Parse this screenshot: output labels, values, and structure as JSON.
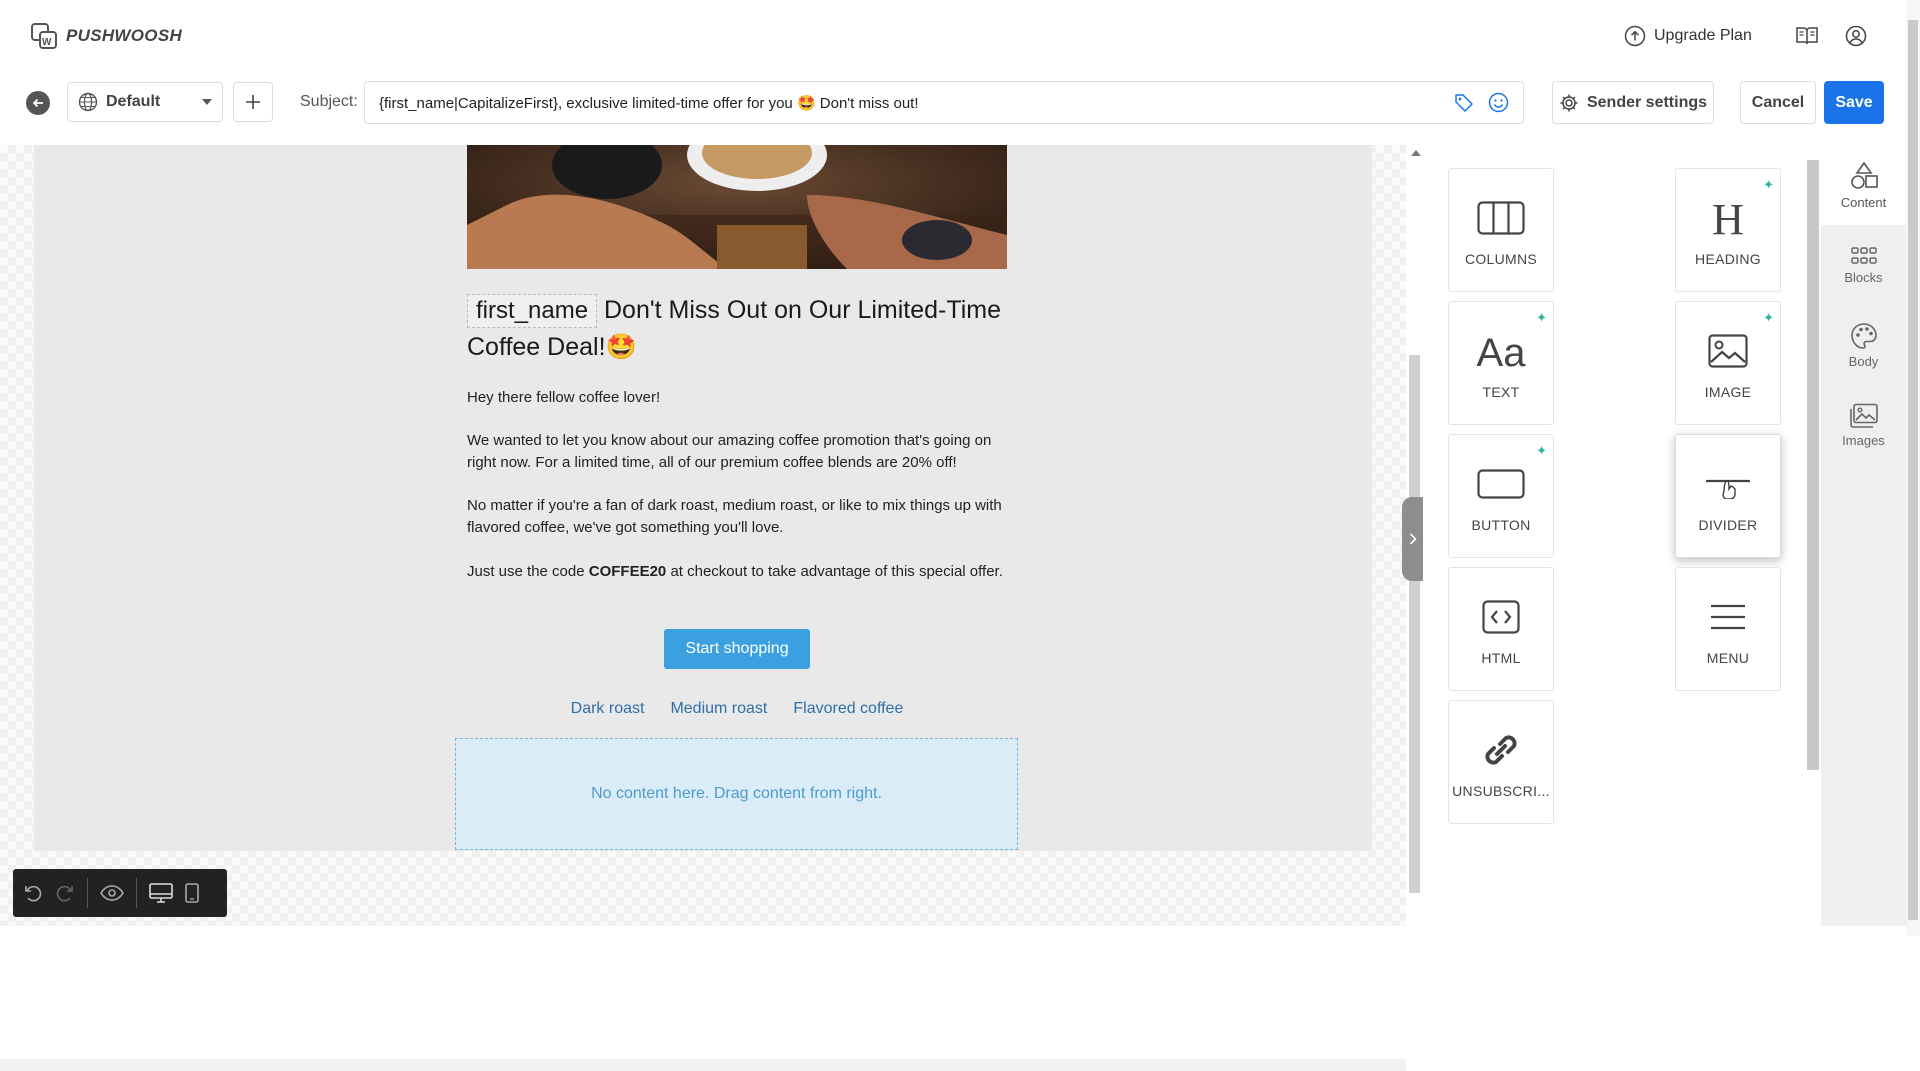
{
  "app": {
    "name": "PUSHWOOSH"
  },
  "header": {
    "upgrade_label": "Upgrade Plan"
  },
  "toolbar": {
    "language": "Default",
    "subject_label": "Subject:",
    "subject_value": "{first_name|CapitalizeFirst}, exclusive limited-time offer for you 🤩 Don't miss out!",
    "sender_settings": "Sender settings",
    "cancel": "Cancel",
    "save": "Save"
  },
  "email": {
    "heading_chip": "first_name",
    "heading_text": "Don't Miss Out on Our Limited-Time Coffee Deal!🤩",
    "greeting": "Hey there fellow coffee lover!",
    "p1": "We wanted to let you know about our amazing coffee promotion that's going on right now. For a limited time, all of our premium coffee blends are 20% off!",
    "p2": "No matter if you're a fan of dark roast, medium roast, or like to mix things up with flavored coffee, we've got something you'll love.",
    "p3_before": "Just use the code ",
    "p3_code": "COFFEE20",
    "p3_after": " at checkout to take advantage of this special offer.",
    "cta": "Start shopping",
    "links": [
      "Dark roast",
      "Medium roast",
      "Flavored coffee"
    ],
    "dropzone": "No content here. Drag content from right."
  },
  "blocks": [
    {
      "label": "COLUMNS",
      "icon": "columns-icon"
    },
    {
      "label": "HEADING",
      "icon": "heading-icon"
    },
    {
      "label": "TEXT",
      "icon": "text-icon"
    },
    {
      "label": "IMAGE",
      "icon": "image-icon"
    },
    {
      "label": "BUTTON",
      "icon": "button-icon"
    },
    {
      "label": "DIVIDER",
      "icon": "divider-icon"
    },
    {
      "label": "HTML",
      "icon": "html-icon"
    },
    {
      "label": "MENU",
      "icon": "menu-icon"
    },
    {
      "label": "UNSUBSCRI...",
      "icon": "link-icon"
    }
  ],
  "tabs": [
    {
      "label": "Content"
    },
    {
      "label": "Blocks"
    },
    {
      "label": "Body"
    },
    {
      "label": "Images"
    }
  ],
  "colors": {
    "accent": "#1a73e8",
    "cta": "#3aa0e0",
    "spark": "#2bb3a3"
  }
}
